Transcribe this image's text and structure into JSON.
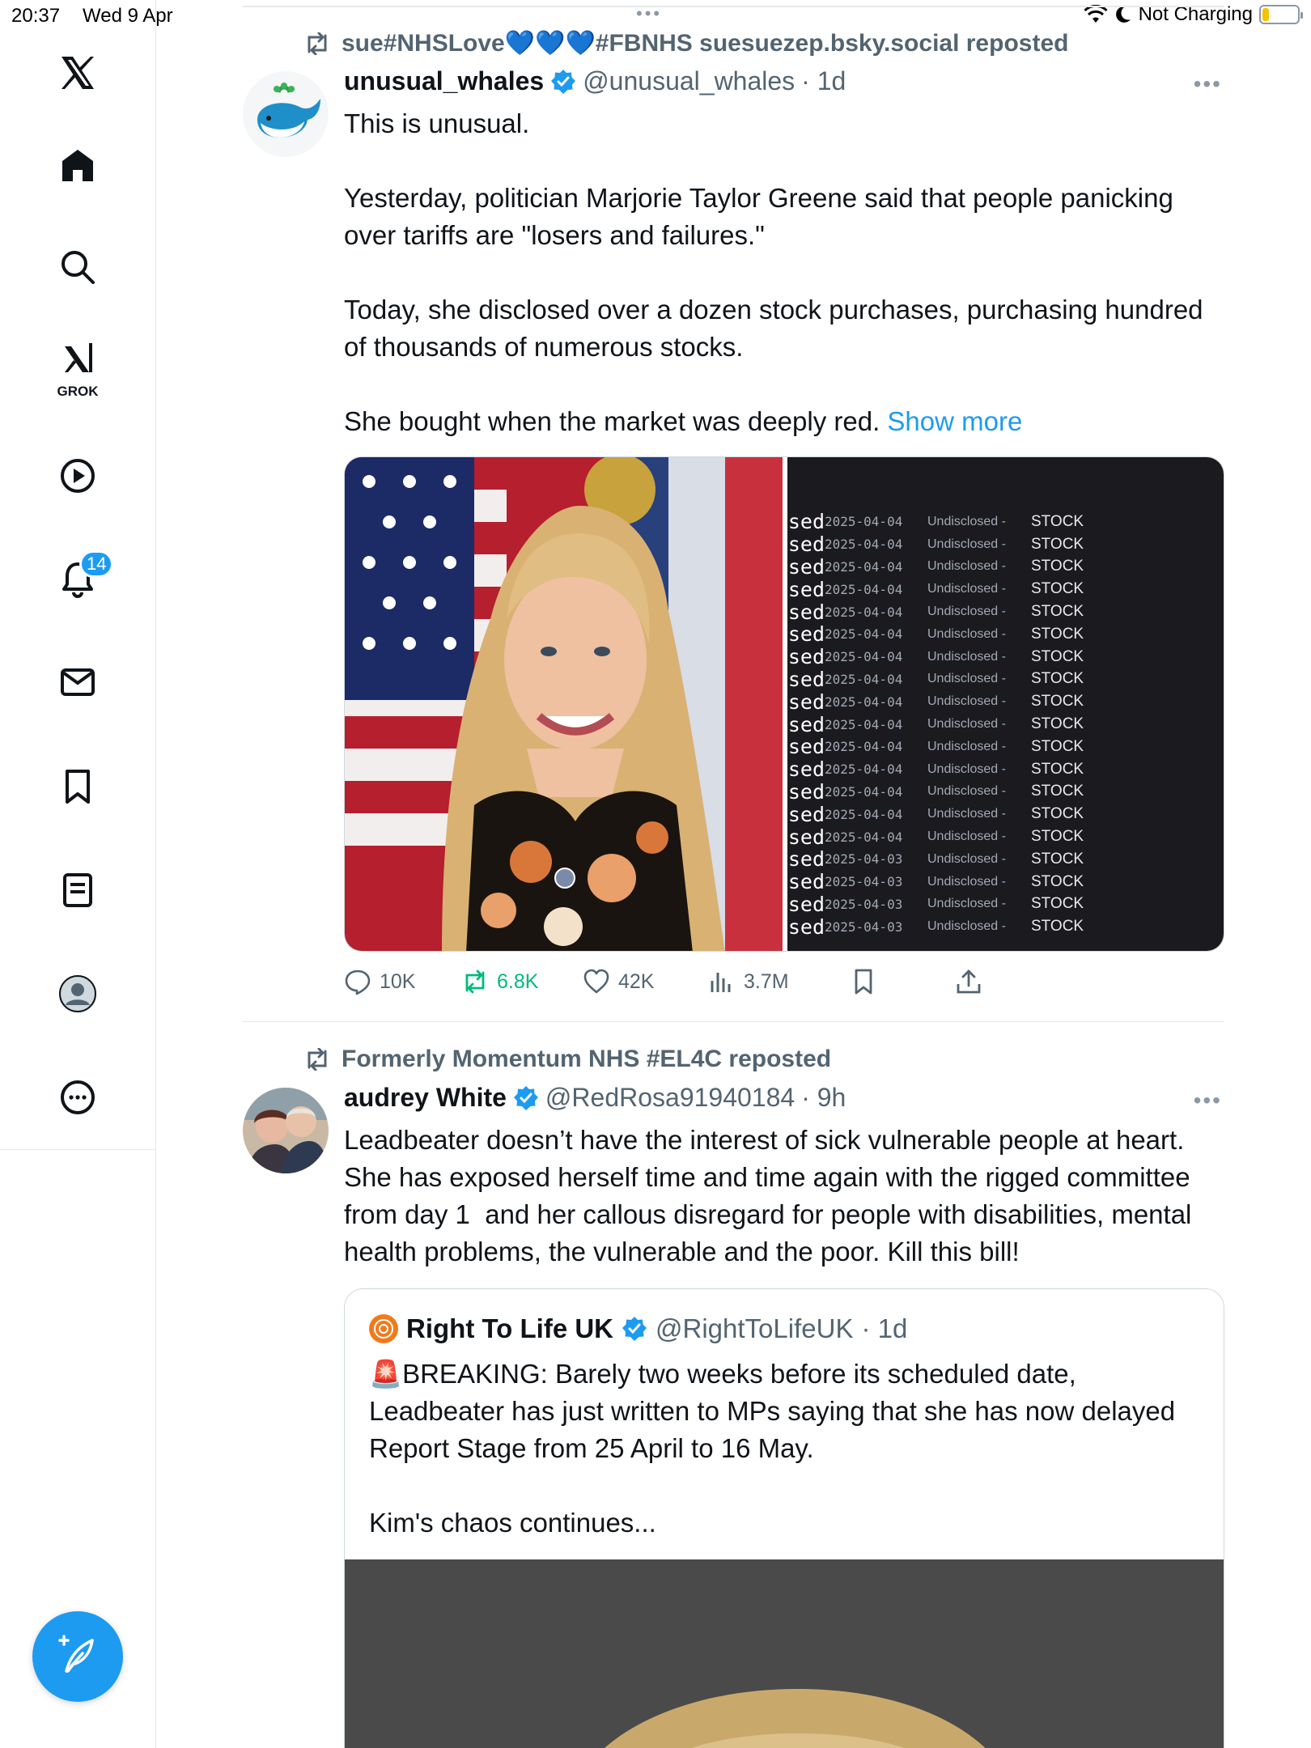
{
  "status_bar": {
    "time": "20:37",
    "date": "Wed 9 Apr",
    "charging": "Not Charging",
    "battery_level": 0.18
  },
  "sidebar": {
    "items": [
      {
        "icon": "x-logo-icon"
      },
      {
        "icon": "home-icon"
      },
      {
        "icon": "search-icon"
      },
      {
        "icon": "grok-icon",
        "label": "GROK"
      },
      {
        "icon": "video-icon"
      },
      {
        "icon": "notifications-icon",
        "badge": "14"
      },
      {
        "icon": "messages-icon"
      },
      {
        "icon": "bookmarks-icon"
      },
      {
        "icon": "lists-icon"
      },
      {
        "icon": "profile-icon"
      },
      {
        "icon": "more-icon"
      }
    ],
    "compose_icon": "compose-post-icon"
  },
  "feed": {
    "posts": [
      {
        "repost_by": "sue#NHSLove💙💙💙#FBNHS suesuezep.bsky.social reposted",
        "name": "unusual_whales",
        "handle": "@unusual_whales",
        "time": "· 1d",
        "verified": true,
        "text": "This is unusual.\n\nYesterday, politician Marjorie Taylor Greene said that people panicking over tariffs are \"losers and failures.\"\n\nToday, she disclosed over a dozen stock purchases, purchasing hundred of thousands of numerous stocks.\n\nShe bought when the market was deeply red. ",
        "show_more": "Show more",
        "media_terminal": {
          "prefix": "sed",
          "label": "Undisclosed -",
          "type": "STOCK",
          "dates": [
            "2025-04-04",
            "2025-04-04",
            "2025-04-04",
            "2025-04-04",
            "2025-04-04",
            "2025-04-04",
            "2025-04-04",
            "2025-04-04",
            "2025-04-04",
            "2025-04-04",
            "2025-04-04",
            "2025-04-04",
            "2025-04-04",
            "2025-04-04",
            "2025-04-04",
            "2025-04-03",
            "2025-04-03",
            "2025-04-03",
            "2025-04-03"
          ]
        },
        "actions": {
          "replies": "10K",
          "reposts": "6.8K",
          "likes": "42K",
          "views": "3.7M"
        }
      },
      {
        "repost_by": "Formerly Momentum NHS #EL4C reposted",
        "name": "audrey White",
        "handle": "@RedRosa91940184",
        "time": "· 9h",
        "verified": true,
        "text": "Leadbeater doesn’t have the interest of sick vulnerable people at heart. She has exposed herself time and time again with the rigged committee from day 1  and her callous disregard for people with disabilities, mental health problems, the vulnerable and the poor. Kill this bill!",
        "quote": {
          "name": "Right To Life UK",
          "handle": "@RightToLifeUK",
          "time": "· 1d",
          "text": "🚨BREAKING: Barely two weeks before its scheduled date, Leadbeater has just written to MPs saying that she has now delayed Report Stage from 25 April to 16 May.\n\nKim's chaos continues..."
        }
      }
    ]
  },
  "colors": {
    "accent": "#1d9bf0",
    "repost_green": "#00ba7c",
    "secondary_text": "#536471",
    "border": "#e7e9ea"
  }
}
